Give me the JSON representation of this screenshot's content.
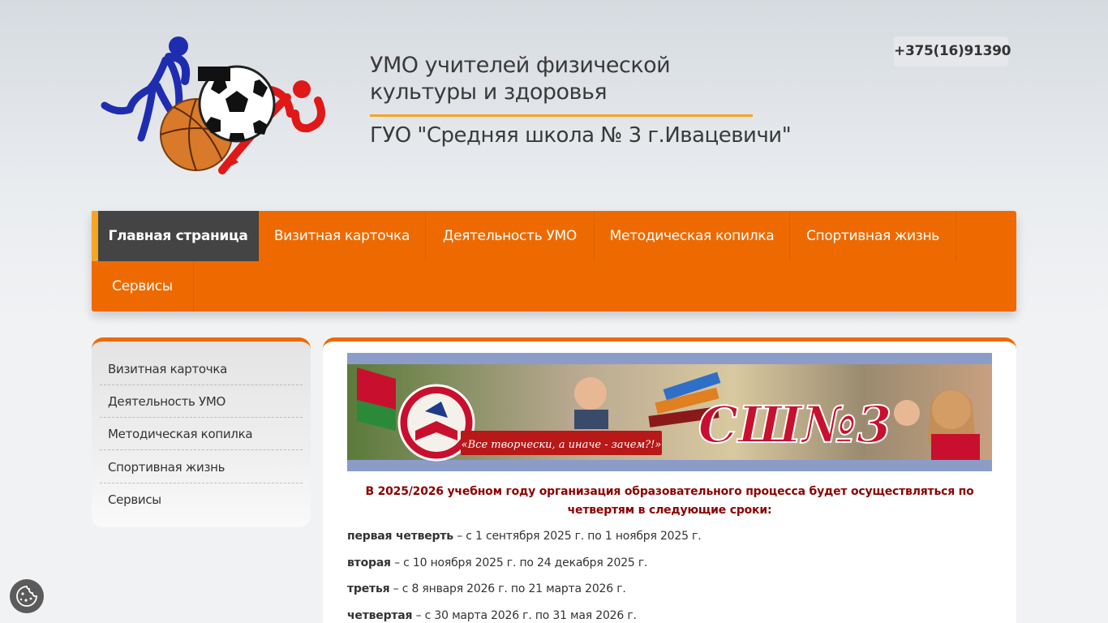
{
  "header": {
    "title": "УМО учителей физической культуры и здоровья",
    "subtitle": "ГУО \"Средняя школа № 3 г.Ивацевичи\"",
    "phone": "+375(16)91390"
  },
  "nav": {
    "items": [
      {
        "label": "Главная страница"
      },
      {
        "label": "Визитная карточка"
      },
      {
        "label": "Деятельность УМО"
      },
      {
        "label": "Методическая копилка"
      },
      {
        "label": "Спортивная жизнь"
      },
      {
        "label": "Сервисы"
      }
    ],
    "active_index": 0
  },
  "sidebar": {
    "items": [
      {
        "label": "Визитная карточка"
      },
      {
        "label": "Деятельность УМО"
      },
      {
        "label": "Методическая копилка"
      },
      {
        "label": "Спортивная жизнь"
      },
      {
        "label": "Сервисы"
      }
    ]
  },
  "banner": {
    "motto": "«Все творчески, а иначе - зачем?!»",
    "school_mark": "СШ№3"
  },
  "content": {
    "notice": "В 2025/2026 учебном году организация образовательного процесса будет осуществляться по четвертям в следующие сроки:",
    "terms": [
      {
        "name": "первая четверть",
        "dates": " – с 1 сентября 2025 г. по 1 ноября 2025 г."
      },
      {
        "name": "вторая",
        "dates": " – с 10 ноября 2025 г. по 24 декабря 2025 г."
      },
      {
        "name": "третья",
        "dates": " – с 8 января 2026 г. по 21 марта 2026 г."
      },
      {
        "name": "четвертая",
        "dates": " – с 30 марта 2026 г. по 31 мая 2026 г."
      }
    ]
  },
  "colors": {
    "accent": "#ee6a00",
    "active_nav": "#444444",
    "notice_text": "#8b0000",
    "title_rule": "#f5a623"
  },
  "icons": {
    "logo": "sports-logo",
    "cookie": "cookie-icon"
  }
}
